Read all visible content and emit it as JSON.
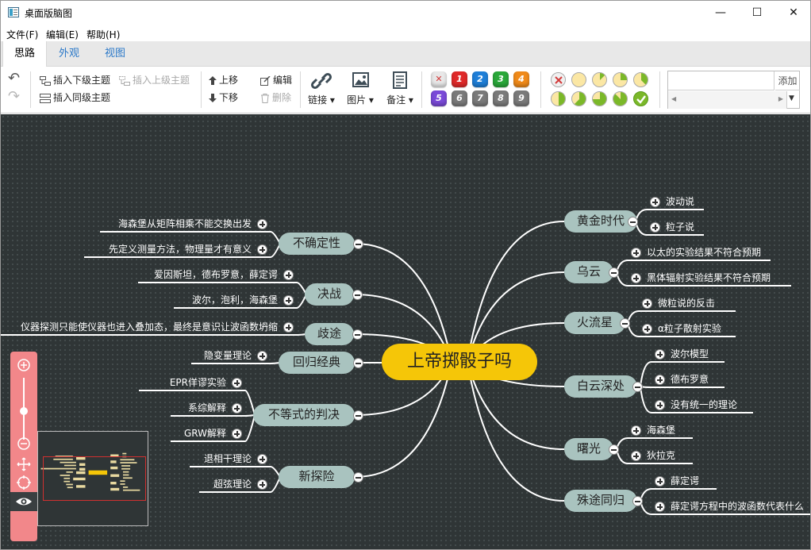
{
  "window": {
    "title": "桌面版脑图",
    "min_glyph": "—",
    "max_glyph": "☐",
    "close_glyph": "✕"
  },
  "menu": [
    "文件(F)",
    "编辑(E)",
    "帮助(H)"
  ],
  "tabs": [
    {
      "label": "思路",
      "active": true
    },
    {
      "label": "外观",
      "active": false
    },
    {
      "label": "视图",
      "active": false
    }
  ],
  "toolbar": {
    "undo_glyph": "↶",
    "redo_glyph": "↷",
    "insert_child": "插入下级主题",
    "insert_parent": "插入上级主题",
    "insert_sibling": "插入同级主题",
    "move_up": "上移",
    "move_down": "下移",
    "edit": "编辑",
    "delete": "删除",
    "link": "链接",
    "image": "图片",
    "note": "备注",
    "dropdown_glyph": "▾",
    "priorities": [
      {
        "label": "✕",
        "color": "#e8e8e8",
        "text_color": "#d23a3a"
      },
      {
        "label": "1",
        "color": "#e02a2a"
      },
      {
        "label": "2",
        "color": "#1f7fd8"
      },
      {
        "label": "3",
        "color": "#2aa83a"
      },
      {
        "label": "4",
        "color": "#f08a1a"
      },
      {
        "label": "5",
        "color": "#7a4ad8"
      },
      {
        "label": "6",
        "color": "#7a7a7a"
      },
      {
        "label": "7",
        "color": "#7a7a7a"
      },
      {
        "label": "8",
        "color": "#7a7a7a"
      },
      {
        "label": "9",
        "color": "#7a7a7a"
      }
    ],
    "progress_levels": [
      0,
      0,
      0.125,
      0.25,
      0.375,
      0.5,
      0.625,
      0.75,
      0.875,
      1
    ],
    "add_button": "添加",
    "add_input_value": ""
  },
  "mindmap": {
    "root": "上帝掷骰子吗",
    "right": [
      {
        "label": "黄金时代",
        "leaves": [
          "波动说",
          "粒子说"
        ]
      },
      {
        "label": "乌云",
        "leaves": [
          "以太的实验结果不符合预期",
          "黑体辐射实验结果不符合预期"
        ]
      },
      {
        "label": "火流星",
        "leaves": [
          "微粒说的反击",
          "α粒子散射实验"
        ]
      },
      {
        "label": "白云深处",
        "leaves": [
          "波尔模型",
          "德布罗意",
          "没有统一的理论"
        ]
      },
      {
        "label": "曙光",
        "leaves": [
          "海森堡",
          "狄拉克"
        ]
      },
      {
        "label": "殊途同归",
        "leaves": [
          "薛定谔",
          "薛定谔方程中的波函数代表什么"
        ]
      }
    ],
    "left": [
      {
        "label": "不确定性",
        "leaves": [
          "海森堡从矩阵相乘不能交换出发",
          "先定义测量方法，物理量才有意义"
        ]
      },
      {
        "label": "决战",
        "leaves": [
          "爱因斯坦，德布罗意，薛定谔",
          "波尔，泡利，海森堡"
        ]
      },
      {
        "label": "歧途",
        "leaves": [
          "仪器探测只能使仪器也进入叠加态，最终是意识让波函数坍缩"
        ]
      },
      {
        "label": "回归经典",
        "leaves": [
          "隐变量理论"
        ]
      },
      {
        "label": "不等式的判决",
        "leaves": [
          "EPR佯谬实验",
          "系综解释",
          "GRW解释"
        ]
      },
      {
        "label": "新探险",
        "leaves": [
          "退相干理论",
          "超弦理论"
        ]
      }
    ]
  },
  "zoom": {
    "zoom_in_glyph": "+",
    "zoom_out_glyph": "−",
    "level": 0.45
  },
  "colors": {
    "canvas": "#2f3536",
    "root": "#f5c608",
    "main_node": "#a9c3bf",
    "zoom_panel": "#f2878a",
    "minimap_view": "#d03030"
  }
}
